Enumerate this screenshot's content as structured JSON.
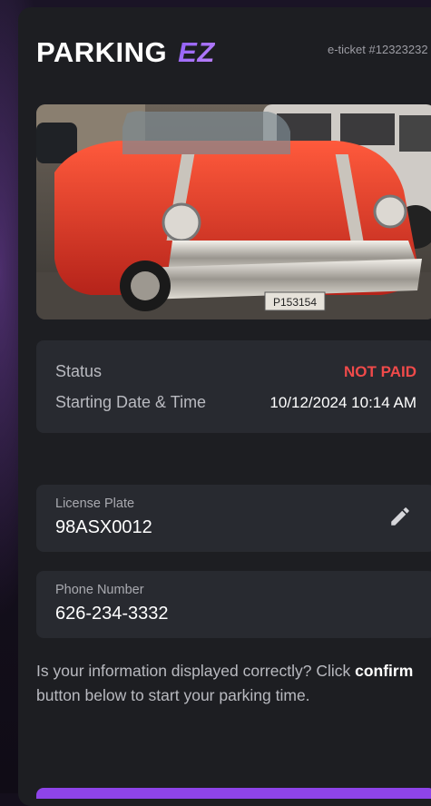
{
  "brand": {
    "name": "PARKING",
    "suffix": "EZ"
  },
  "ticket": {
    "label": "e-ticket #12323232"
  },
  "status": {
    "status_label": "Status",
    "status_value": "NOT PAID",
    "start_label": "Starting Date & Time",
    "start_value": "10/12/2024 10:14 AM"
  },
  "license": {
    "label": "License Plate",
    "value": "98ASX0012"
  },
  "phone": {
    "label": "Phone Number",
    "value": "626-234-3332"
  },
  "info": {
    "line_start": "Is your information displayed correctly? Click ",
    "confirm_word": "confirm",
    "line_end": " button below to start your parking time."
  },
  "vehicle": {
    "plate_text": "P153154"
  },
  "colors": {
    "accent": "#8e44e8",
    "not_paid": "#f04a4a",
    "panel": "#282a30",
    "card": "#1d1e22"
  }
}
